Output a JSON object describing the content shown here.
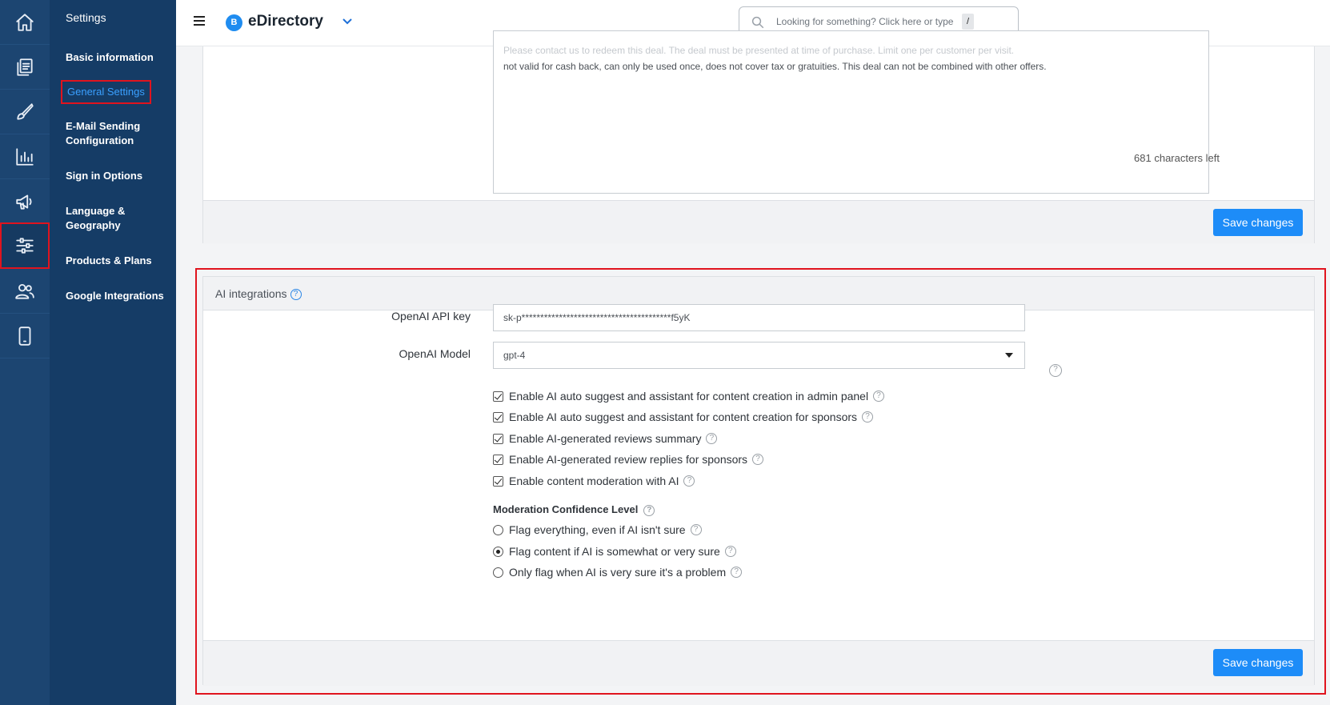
{
  "rail": {
    "items": [
      {
        "name": "home-icon",
        "active": false
      },
      {
        "name": "content-icon",
        "active": false
      },
      {
        "name": "design-icon",
        "active": false
      },
      {
        "name": "reports-icon",
        "active": false
      },
      {
        "name": "promote-icon",
        "active": false
      },
      {
        "name": "settings-sliders-icon",
        "active": true
      },
      {
        "name": "users-icon",
        "active": false
      },
      {
        "name": "mobile-icon",
        "active": false
      }
    ]
  },
  "sidebar": {
    "title": "Settings",
    "items": [
      {
        "label": "Basic information"
      },
      {
        "label": "General Settings",
        "active": true
      },
      {
        "label": "E-Mail Sending Configuration"
      },
      {
        "label": "Sign in Options"
      },
      {
        "label": "Language & Geography"
      },
      {
        "label": "Products & Plans"
      },
      {
        "label": "Google Integrations"
      }
    ]
  },
  "topbar": {
    "logo_letter": "B",
    "app_name": "eDirectory",
    "search_placeholder": "Looking for something? Click here or type",
    "search_shortcut": "/"
  },
  "deal_panel": {
    "description_faded": "Please contact us to redeem this deal. The deal must be presented at time of purchase. Limit one per customer per visit.",
    "description_text": "not valid for cash back, can only be used once, does not cover tax or gratuities. This deal can not be combined with other offers.",
    "chars_left": "681 characters left",
    "save_label": "Save changes"
  },
  "ai_panel": {
    "title": "AI integrations",
    "api_key_label": "OpenAI API key",
    "api_key_value": "sk-p****************************************f5yK",
    "model_label": "OpenAI Model",
    "model_value": "gpt-4",
    "options": [
      {
        "label": "Enable AI auto suggest and assistant for content creation in admin panel",
        "checked": true
      },
      {
        "label": "Enable AI auto suggest and assistant for content creation for sponsors",
        "checked": true
      },
      {
        "label": "Enable AI-generated reviews summary",
        "checked": true
      },
      {
        "label": "Enable AI-generated review replies for sponsors",
        "checked": true
      },
      {
        "label": "Enable content moderation with AI",
        "checked": true
      }
    ],
    "moderation_heading": "Moderation Confidence Level",
    "moderation_levels": [
      {
        "label": "Flag everything, even if AI isn't sure",
        "selected": false
      },
      {
        "label": "Flag content if AI is somewhat or very sure",
        "selected": true
      },
      {
        "label": "Only flag when AI is very sure it's a problem",
        "selected": false
      }
    ],
    "save_label": "Save changes"
  },
  "colors": {
    "rail_bg": "#1c4571",
    "sidebar_bg": "#153c66",
    "accent": "#1d8cf8",
    "highlight": "#e0141e"
  }
}
